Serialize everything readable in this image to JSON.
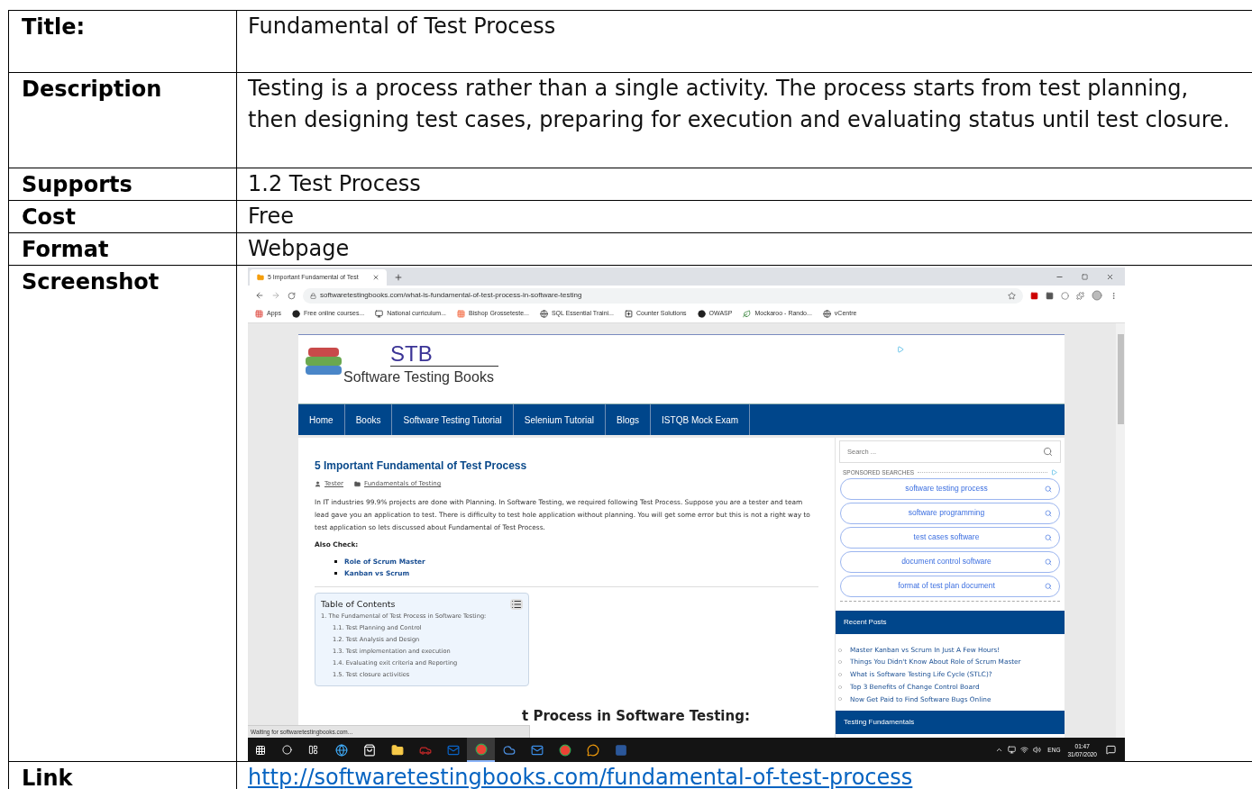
{
  "rows": [
    {
      "kind": "text",
      "label": "Title:",
      "value": "Fundamental of Test Process"
    },
    {
      "kind": "text",
      "label": "Description",
      "value": "Testing is a process rather than a single activity. The process starts from test planning, then designing test cases, preparing for execution and evaluating status until test closure."
    },
    {
      "kind": "text",
      "label": "Supports",
      "value": "1.2 Test Process"
    },
    {
      "kind": "text",
      "label": "Cost",
      "value": "Free"
    },
    {
      "kind": "text",
      "label": "Format",
      "value": "Webpage"
    },
    {
      "kind": "screenshot",
      "label": "Screenshot"
    },
    {
      "kind": "link",
      "label": "Link",
      "value": "http://softwaretestingbooks.com/fundamental-of-test-process"
    }
  ],
  "screenshot": {
    "tab": {
      "title": "5 Important Fundamental of Test"
    },
    "address": "softwaretestingbooks.com/what-is-fundamental-of-test-process-in-software-testing",
    "bookmarks": [
      {
        "kind": "apps",
        "label": "Apps"
      },
      {
        "kind": "dot",
        "label": "Free online courses..."
      },
      {
        "kind": "box",
        "label": "National curriculum..."
      },
      {
        "kind": "tiles",
        "label": "Bishop Grosseteste..."
      },
      {
        "kind": "globe",
        "label": "SQL Essential Traini..."
      },
      {
        "kind": "plus",
        "label": "Counter Solutions"
      },
      {
        "kind": "dot",
        "label": "OWASP"
      },
      {
        "kind": "leaf",
        "label": "Mockaroo - Rando..."
      },
      {
        "kind": "globe",
        "label": "vCentre"
      }
    ],
    "site": {
      "logo_title": "STB",
      "logo_subtitle": "Software Testing Books",
      "nav": [
        "Home",
        "Books",
        "Software Testing Tutorial",
        "Selenium Tutorial",
        "Blogs",
        "ISTQB Mock Exam"
      ]
    },
    "article": {
      "title": "5 Important Fundamental of Test Process",
      "author": "Tester",
      "category": "Fundamentals of Testing",
      "paragraph": "In IT industries 99.9% projects are done with Planning. In Software Testing, we required following Test Process. Suppose you are a tester and team lead gave you an application to test. There is difficulty to test hole application without planning. You will get some error but this is not a right way to test application so lets discussed about Fundamental of Test Process.",
      "also_check": "Also Check:",
      "links": [
        "Role of Scrum Master",
        "Kanban vs Scrum"
      ],
      "toc": {
        "title": "Table of Contents",
        "items": [
          {
            "label": "1. The Fundamental of Test Process in Software Testing:",
            "children": [
              {
                "label": "1.1. Test Planning and Control"
              },
              {
                "label": "1.2. Test Analysis and Design"
              },
              {
                "label": "1.3. Test implementation and execution"
              },
              {
                "label": "1.4. Evaluating exit criteria and Reporting"
              },
              {
                "label": "1.5. Test closure activities"
              }
            ]
          }
        ]
      },
      "partial_heading": "t Process in Software Testing:"
    },
    "status": "Waiting for softwaretestingbooks.com...",
    "sidebar": {
      "search_placeholder": "Search ...",
      "sponsored": "SPONSORED SEARCHES",
      "searches": [
        "software testing process",
        "software programming",
        "test cases software",
        "document control software",
        "format of test plan document"
      ],
      "recent_title": "Recent Posts",
      "posts": [
        "Master Kanban vs Scrum In Just A Few Hours!",
        "Things You Didn't Know About Role of Scrum Master",
        "What is Software Testing Life Cycle (STLC)?",
        "Top 3 Benefits of Change Control Board",
        "Now Get Paid to Find Software Bugs Online"
      ],
      "next_title": "Testing Fundamentals"
    },
    "taskbar": {
      "apps": [
        {
          "kind": "edge",
          "selected": false
        },
        {
          "kind": "store",
          "selected": false
        },
        {
          "kind": "folder",
          "selected": false
        },
        {
          "kind": "car",
          "selected": false
        },
        {
          "kind": "outlook",
          "selected": false
        },
        {
          "kind": "chrome",
          "selected": true
        },
        {
          "kind": "cloud",
          "selected": false
        },
        {
          "kind": "mail",
          "selected": false
        },
        {
          "kind": "chrome",
          "selected": false
        },
        {
          "kind": "chat",
          "selected": false
        },
        {
          "kind": "word",
          "selected": false
        }
      ],
      "lang": "ENG",
      "time": "01:47",
      "date": "31/07/2020"
    }
  }
}
